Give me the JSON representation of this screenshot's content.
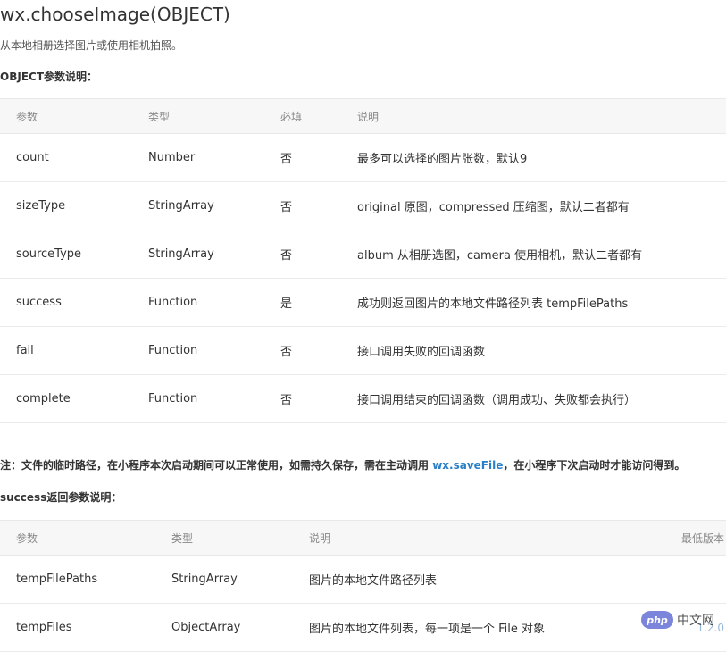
{
  "title": "wx.chooseImage(OBJECT)",
  "description": "从本地相册选择图片或使用相机拍照。",
  "object_params": {
    "heading": "OBJECT参数说明：",
    "headers": [
      "参数",
      "类型",
      "必填",
      "说明"
    ],
    "rows": [
      [
        "count",
        "Number",
        "否",
        "最多可以选择的图片张数，默认9"
      ],
      [
        "sizeType",
        "StringArray",
        "否",
        "original 原图，compressed 压缩图，默认二者都有"
      ],
      [
        "sourceType",
        "StringArray",
        "否",
        "album 从相册选图，camera 使用相机，默认二者都有"
      ],
      [
        "success",
        "Function",
        "是",
        "成功则返回图片的本地文件路径列表 tempFilePaths"
      ],
      [
        "fail",
        "Function",
        "否",
        "接口调用失败的回调函数"
      ],
      [
        "complete",
        "Function",
        "否",
        "接口调用结束的回调函数（调用成功、失败都会执行）"
      ]
    ]
  },
  "note": {
    "prefix": "注：文件的临时路径，在小程序本次启动期间可以正常使用，如需持久保存，需在主动调用 ",
    "link": "wx.saveFile",
    "suffix": "，在小程序下次启动时才能访问得到。"
  },
  "success_params": {
    "heading": "success返回参数说明：",
    "headers": [
      "参数",
      "类型",
      "说明",
      "最低版本"
    ],
    "rows": [
      [
        "tempFilePaths",
        "StringArray",
        "图片的本地文件路径列表",
        ""
      ],
      [
        "tempFiles",
        "ObjectArray",
        "图片的本地文件列表，每一项是一个 File 对象",
        "1.2.0"
      ]
    ]
  },
  "watermark": {
    "logo": "php",
    "text": "中文网"
  }
}
